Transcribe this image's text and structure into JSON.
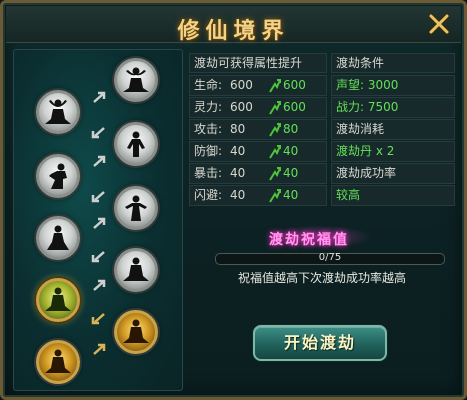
{
  "window": {
    "title": "修仙境界"
  },
  "attributes": {
    "header_left": "渡劫可获得属性提升",
    "header_right": "渡劫条件",
    "stats": [
      {
        "label": "生命:",
        "current": "600",
        "next": "600"
      },
      {
        "label": "灵力:",
        "current": "600",
        "next": "600"
      },
      {
        "label": "攻击:",
        "current": "80",
        "next": "80"
      },
      {
        "label": "防御:",
        "current": "40",
        "next": "40"
      },
      {
        "label": "暴击:",
        "current": "40",
        "next": "40"
      },
      {
        "label": "闪避:",
        "current": "40",
        "next": "40"
      }
    ],
    "conditions": [
      {
        "text": "声望: 3000",
        "color": "green"
      },
      {
        "text": "战力: 7500",
        "color": "green"
      },
      {
        "text": "渡劫消耗",
        "color": "white"
      },
      {
        "text": "渡劫丹 x 2",
        "color": "green"
      },
      {
        "text": "渡劫成功率",
        "color": "white"
      },
      {
        "text": "较高",
        "color": "green"
      }
    ]
  },
  "blessing": {
    "title": "渡劫祝福值",
    "progress_text": "0/75",
    "progress_fraction": 0,
    "note": "祝福值越高下次渡劫成功率越高"
  },
  "start_button": {
    "label": "开始渡劫"
  },
  "colors": {
    "title_gold": "#f2d488",
    "green_text": "#63e05a",
    "pink_glow": "#ff9cf0",
    "button_teal": "#2f7a72"
  },
  "realm_nodes": [
    {
      "icon": "meditation-figure-icon",
      "state": "locked"
    },
    {
      "icon": "meditation-figure-icon",
      "state": "locked"
    },
    {
      "icon": "martial-figure-icon",
      "state": "locked"
    },
    {
      "icon": "martial-figure-icon",
      "state": "locked"
    },
    {
      "icon": "kneeling-figure-icon",
      "state": "locked"
    },
    {
      "icon": "kneeling-figure-icon",
      "state": "locked"
    },
    {
      "icon": "seated-figure-icon",
      "state": "locked"
    },
    {
      "icon": "seated-figure-icon",
      "state": "locked"
    },
    {
      "icon": "meditation-figure-icon",
      "state": "current"
    },
    {
      "icon": "seated-figure-icon",
      "state": "gold"
    },
    {
      "icon": "seated-figure-icon",
      "state": "gold"
    }
  ]
}
